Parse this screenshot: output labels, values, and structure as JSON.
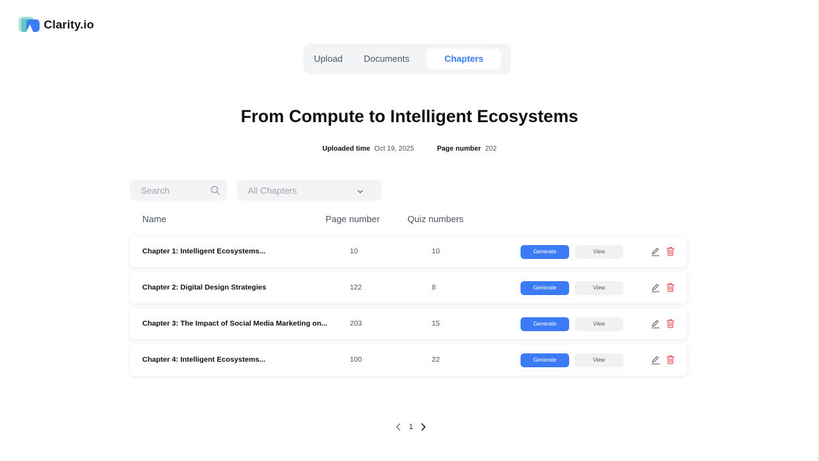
{
  "brand": {
    "name": "Clarity.io",
    "colors": {
      "accent": "#3b7bf6",
      "danger": "#e5484d",
      "logo_teal": "#5fc6c0",
      "logo_blue": "#3b7bf6"
    }
  },
  "tabs": [
    {
      "label": "Upload",
      "active": false
    },
    {
      "label": "Documents",
      "active": false
    },
    {
      "label": "Chapters",
      "active": true
    }
  ],
  "document": {
    "title": "From Compute to Intelligent Ecosystems",
    "uploaded_label": "Uploaded time",
    "uploaded_value": "Oct 19, 2025",
    "page_label": "Page number",
    "page_value": "202"
  },
  "filters": {
    "search_placeholder": "Search",
    "select_value": "All Chapters"
  },
  "table": {
    "headers": {
      "name": "Name",
      "page": "Page number",
      "quiz": "Quiz numbers"
    },
    "rows": [
      {
        "name": "Chapter 1: Intelligent Ecosystems...",
        "page": "10",
        "quiz": "10",
        "generate": "Generate",
        "view": "View"
      },
      {
        "name": "Chapter 2: Digital Design Strategies",
        "page": "122",
        "quiz": "8",
        "generate": "Generate",
        "view": "View"
      },
      {
        "name": "Chapter 3: The Impact of Social Media Marketing on...",
        "page": "203",
        "quiz": "15",
        "generate": "Generate",
        "view": "View"
      },
      {
        "name": "Chapter 4: Intelligent Ecosystems...",
        "page": "100",
        "quiz": "22",
        "generate": "Generate",
        "view": "View"
      }
    ]
  },
  "pagination": {
    "current": "1"
  },
  "icons": [
    "logo-icon",
    "search-icon",
    "chevron-down-icon",
    "edit-icon",
    "trash-icon",
    "chevron-left-icon",
    "chevron-right-icon"
  ]
}
